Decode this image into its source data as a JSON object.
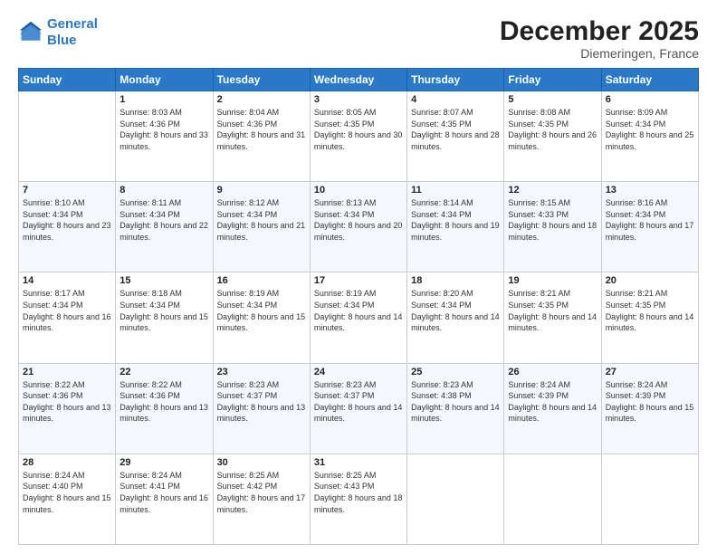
{
  "logo": {
    "line1": "General",
    "line2": "Blue"
  },
  "header": {
    "title": "December 2025",
    "subtitle": "Diemeringen, France"
  },
  "days_of_week": [
    "Sunday",
    "Monday",
    "Tuesday",
    "Wednesday",
    "Thursday",
    "Friday",
    "Saturday"
  ],
  "weeks": [
    [
      {
        "num": "",
        "sunrise": "",
        "sunset": "",
        "daylight": ""
      },
      {
        "num": "1",
        "sunrise": "Sunrise: 8:03 AM",
        "sunset": "Sunset: 4:36 PM",
        "daylight": "Daylight: 8 hours and 33 minutes."
      },
      {
        "num": "2",
        "sunrise": "Sunrise: 8:04 AM",
        "sunset": "Sunset: 4:36 PM",
        "daylight": "Daylight: 8 hours and 31 minutes."
      },
      {
        "num": "3",
        "sunrise": "Sunrise: 8:05 AM",
        "sunset": "Sunset: 4:35 PM",
        "daylight": "Daylight: 8 hours and 30 minutes."
      },
      {
        "num": "4",
        "sunrise": "Sunrise: 8:07 AM",
        "sunset": "Sunset: 4:35 PM",
        "daylight": "Daylight: 8 hours and 28 minutes."
      },
      {
        "num": "5",
        "sunrise": "Sunrise: 8:08 AM",
        "sunset": "Sunset: 4:35 PM",
        "daylight": "Daylight: 8 hours and 26 minutes."
      },
      {
        "num": "6",
        "sunrise": "Sunrise: 8:09 AM",
        "sunset": "Sunset: 4:34 PM",
        "daylight": "Daylight: 8 hours and 25 minutes."
      }
    ],
    [
      {
        "num": "7",
        "sunrise": "Sunrise: 8:10 AM",
        "sunset": "Sunset: 4:34 PM",
        "daylight": "Daylight: 8 hours and 23 minutes."
      },
      {
        "num": "8",
        "sunrise": "Sunrise: 8:11 AM",
        "sunset": "Sunset: 4:34 PM",
        "daylight": "Daylight: 8 hours and 22 minutes."
      },
      {
        "num": "9",
        "sunrise": "Sunrise: 8:12 AM",
        "sunset": "Sunset: 4:34 PM",
        "daylight": "Daylight: 8 hours and 21 minutes."
      },
      {
        "num": "10",
        "sunrise": "Sunrise: 8:13 AM",
        "sunset": "Sunset: 4:34 PM",
        "daylight": "Daylight: 8 hours and 20 minutes."
      },
      {
        "num": "11",
        "sunrise": "Sunrise: 8:14 AM",
        "sunset": "Sunset: 4:34 PM",
        "daylight": "Daylight: 8 hours and 19 minutes."
      },
      {
        "num": "12",
        "sunrise": "Sunrise: 8:15 AM",
        "sunset": "Sunset: 4:33 PM",
        "daylight": "Daylight: 8 hours and 18 minutes."
      },
      {
        "num": "13",
        "sunrise": "Sunrise: 8:16 AM",
        "sunset": "Sunset: 4:34 PM",
        "daylight": "Daylight: 8 hours and 17 minutes."
      }
    ],
    [
      {
        "num": "14",
        "sunrise": "Sunrise: 8:17 AM",
        "sunset": "Sunset: 4:34 PM",
        "daylight": "Daylight: 8 hours and 16 minutes."
      },
      {
        "num": "15",
        "sunrise": "Sunrise: 8:18 AM",
        "sunset": "Sunset: 4:34 PM",
        "daylight": "Daylight: 8 hours and 15 minutes."
      },
      {
        "num": "16",
        "sunrise": "Sunrise: 8:19 AM",
        "sunset": "Sunset: 4:34 PM",
        "daylight": "Daylight: 8 hours and 15 minutes."
      },
      {
        "num": "17",
        "sunrise": "Sunrise: 8:19 AM",
        "sunset": "Sunset: 4:34 PM",
        "daylight": "Daylight: 8 hours and 14 minutes."
      },
      {
        "num": "18",
        "sunrise": "Sunrise: 8:20 AM",
        "sunset": "Sunset: 4:34 PM",
        "daylight": "Daylight: 8 hours and 14 minutes."
      },
      {
        "num": "19",
        "sunrise": "Sunrise: 8:21 AM",
        "sunset": "Sunset: 4:35 PM",
        "daylight": "Daylight: 8 hours and 14 minutes."
      },
      {
        "num": "20",
        "sunrise": "Sunrise: 8:21 AM",
        "sunset": "Sunset: 4:35 PM",
        "daylight": "Daylight: 8 hours and 14 minutes."
      }
    ],
    [
      {
        "num": "21",
        "sunrise": "Sunrise: 8:22 AM",
        "sunset": "Sunset: 4:36 PM",
        "daylight": "Daylight: 8 hours and 13 minutes."
      },
      {
        "num": "22",
        "sunrise": "Sunrise: 8:22 AM",
        "sunset": "Sunset: 4:36 PM",
        "daylight": "Daylight: 8 hours and 13 minutes."
      },
      {
        "num": "23",
        "sunrise": "Sunrise: 8:23 AM",
        "sunset": "Sunset: 4:37 PM",
        "daylight": "Daylight: 8 hours and 13 minutes."
      },
      {
        "num": "24",
        "sunrise": "Sunrise: 8:23 AM",
        "sunset": "Sunset: 4:37 PM",
        "daylight": "Daylight: 8 hours and 14 minutes."
      },
      {
        "num": "25",
        "sunrise": "Sunrise: 8:23 AM",
        "sunset": "Sunset: 4:38 PM",
        "daylight": "Daylight: 8 hours and 14 minutes."
      },
      {
        "num": "26",
        "sunrise": "Sunrise: 8:24 AM",
        "sunset": "Sunset: 4:39 PM",
        "daylight": "Daylight: 8 hours and 14 minutes."
      },
      {
        "num": "27",
        "sunrise": "Sunrise: 8:24 AM",
        "sunset": "Sunset: 4:39 PM",
        "daylight": "Daylight: 8 hours and 15 minutes."
      }
    ],
    [
      {
        "num": "28",
        "sunrise": "Sunrise: 8:24 AM",
        "sunset": "Sunset: 4:40 PM",
        "daylight": "Daylight: 8 hours and 15 minutes."
      },
      {
        "num": "29",
        "sunrise": "Sunrise: 8:24 AM",
        "sunset": "Sunset: 4:41 PM",
        "daylight": "Daylight: 8 hours and 16 minutes."
      },
      {
        "num": "30",
        "sunrise": "Sunrise: 8:25 AM",
        "sunset": "Sunset: 4:42 PM",
        "daylight": "Daylight: 8 hours and 17 minutes."
      },
      {
        "num": "31",
        "sunrise": "Sunrise: 8:25 AM",
        "sunset": "Sunset: 4:43 PM",
        "daylight": "Daylight: 8 hours and 18 minutes."
      },
      {
        "num": "",
        "sunrise": "",
        "sunset": "",
        "daylight": ""
      },
      {
        "num": "",
        "sunrise": "",
        "sunset": "",
        "daylight": ""
      },
      {
        "num": "",
        "sunrise": "",
        "sunset": "",
        "daylight": ""
      }
    ]
  ]
}
